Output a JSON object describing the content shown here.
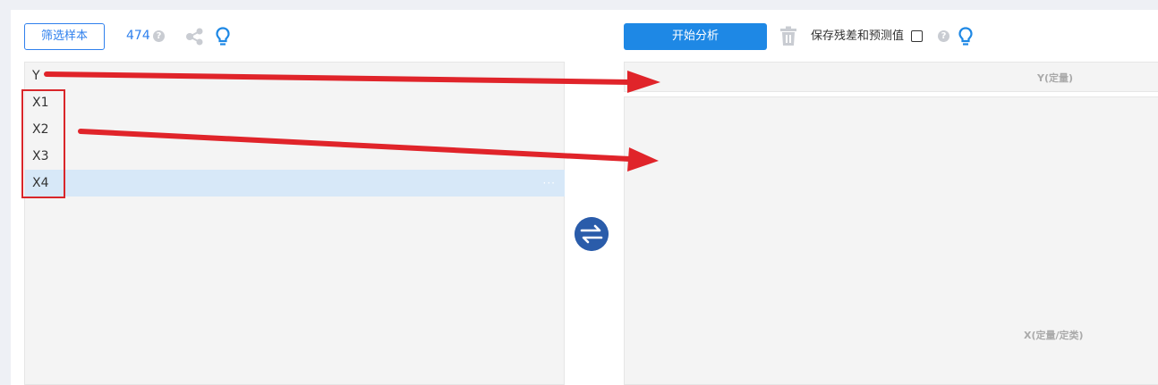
{
  "toolbar": {
    "filter_label": "筛选样本",
    "sample_count": "474",
    "start_label": "开始分析",
    "save_residual_label": "保存残差和预测值",
    "save_residual_checked": false
  },
  "variables": [
    {
      "label": "Y",
      "selected": false
    },
    {
      "label": "X1",
      "selected": false
    },
    {
      "label": "X2",
      "selected": false
    },
    {
      "label": "X3",
      "selected": false
    },
    {
      "label": "X4",
      "selected": true,
      "more": "···"
    }
  ],
  "targets": {
    "y_label": "Y(定量)",
    "x_label": "X(定量/定类)"
  },
  "icons": [
    "help-icon",
    "share-icon",
    "bulb-icon",
    "trash-icon",
    "swap-icon",
    "more-icon"
  ],
  "colors": {
    "accent": "#1e88e5",
    "swap": "#2a5caa",
    "annotation": "#d9262a",
    "selected_row": "#d7e8f8"
  }
}
